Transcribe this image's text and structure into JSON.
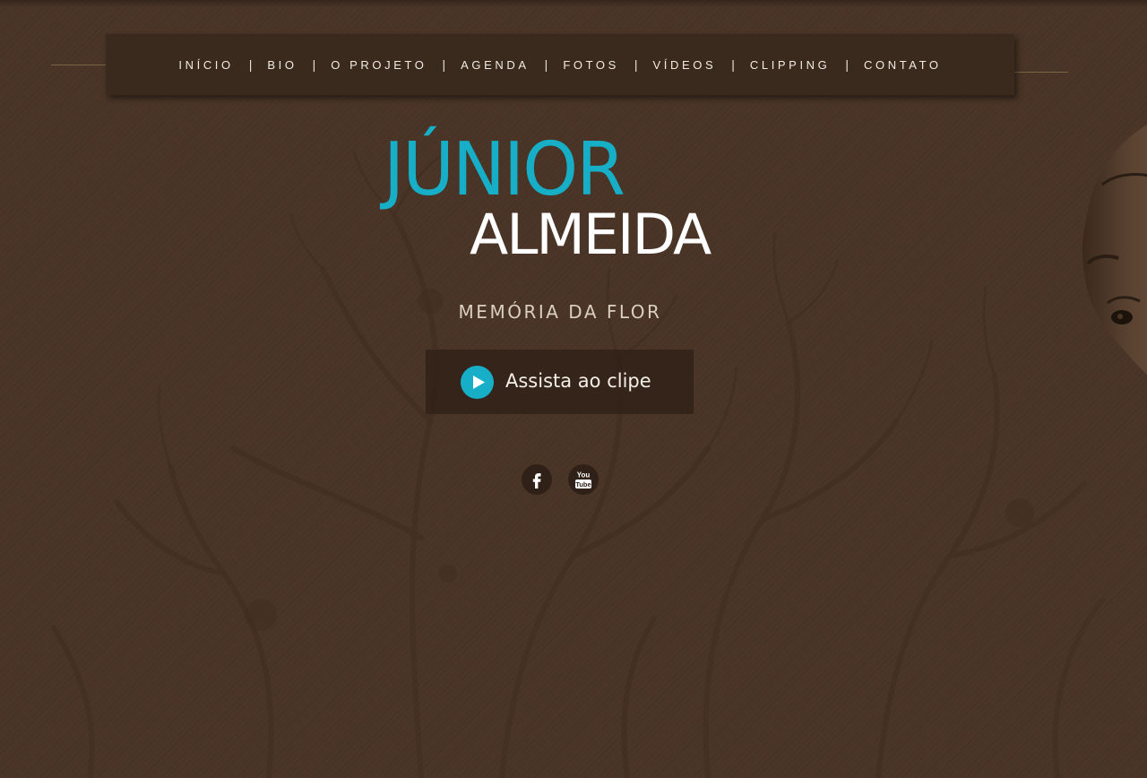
{
  "nav": {
    "items": [
      {
        "label": "INÍCIO"
      },
      {
        "label": "BIO"
      },
      {
        "label": "O PROJETO"
      },
      {
        "label": "AGENDA"
      },
      {
        "label": "FOTOS"
      },
      {
        "label": "VÍDEOS"
      },
      {
        "label": "CLIPPING"
      },
      {
        "label": "CONTATO"
      }
    ],
    "separator": "|"
  },
  "logo": {
    "first_name": "JÚNIOR",
    "last_name": "ALMEIDA"
  },
  "subtitle": "MEMÓRIA DA FLOR",
  "cta": {
    "label": "Assista ao clipe",
    "icon": "play-icon"
  },
  "social": {
    "facebook_icon": "facebook-icon",
    "youtube_icon": "youtube-icon",
    "youtube_text_line1": "You",
    "youtube_text_line2": "Tube"
  },
  "colors": {
    "background": "#4a3527",
    "nav_background": "#3a2a1e",
    "accent": "#16afc7",
    "text": "#f1ebe3"
  }
}
